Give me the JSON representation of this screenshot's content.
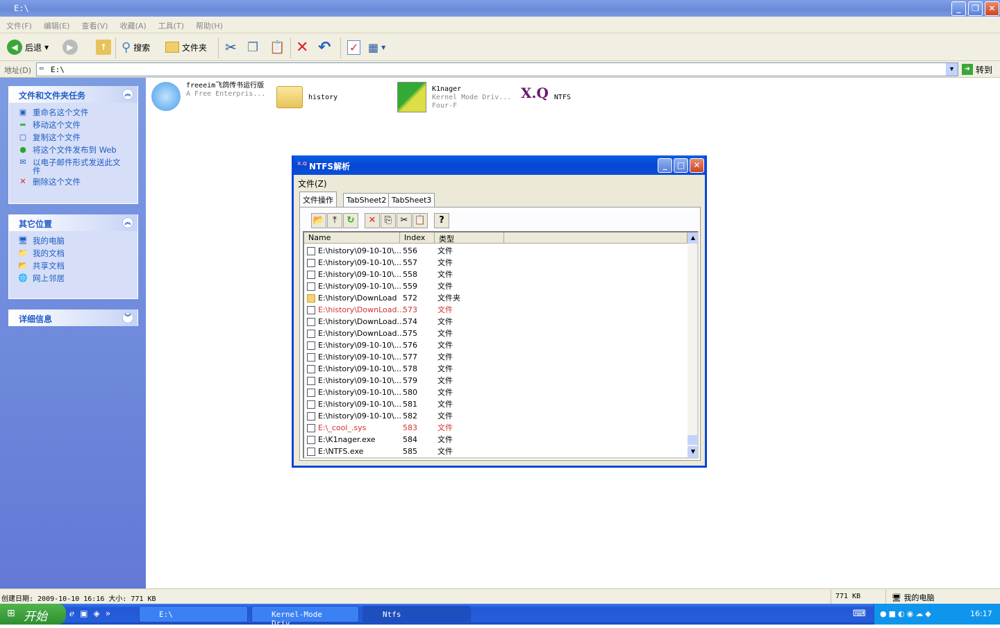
{
  "window": {
    "title": "E:\\",
    "min": "_",
    "max": "❐",
    "close": "✕"
  },
  "menu": [
    "文件(F)",
    "编辑(E)",
    "查看(V)",
    "收藏(A)",
    "工具(T)",
    "帮助(H)"
  ],
  "toolbar": {
    "back": "后退",
    "search": "搜索",
    "folders": "文件夹"
  },
  "address": {
    "label": "地址(D)",
    "value": "E:\\",
    "go": "转到"
  },
  "left": {
    "tasks": {
      "title": "文件和文件夹任务",
      "items": [
        "重命名这个文件",
        "移动这个文件",
        "复制这个文件",
        "将这个文件发布到 Web",
        "以电子邮件形式发送此文件",
        "删除这个文件"
      ]
    },
    "places": {
      "title": "其它位置",
      "items": [
        "我的电脑",
        "我的文档",
        "共享文档",
        "网上邻居"
      ]
    },
    "details": {
      "title": "详细信息"
    }
  },
  "files": [
    {
      "name": "freeeim飞鸽传书运行版",
      "sub": "A Free Enterpris..."
    },
    {
      "name": "history"
    },
    {
      "name": "K1nager",
      "sub": "Kernel Mode Driv...",
      "sub2": "Four-F"
    },
    {
      "name": "NTFS",
      "logo": "X.Q"
    }
  ],
  "dialog": {
    "title": "NTFS解析",
    "menu": "文件(Z)",
    "tabs": [
      "文件操作",
      "TabSheet2",
      "TabSheet3"
    ],
    "columns": [
      "Name",
      "Index",
      "类型"
    ],
    "rows": [
      {
        "name": "E:\\history\\09-10-10\\...",
        "index": "556",
        "type": "文件"
      },
      {
        "name": "E:\\history\\09-10-10\\...",
        "index": "557",
        "type": "文件"
      },
      {
        "name": "E:\\history\\09-10-10\\...",
        "index": "558",
        "type": "文件"
      },
      {
        "name": "E:\\history\\09-10-10\\...",
        "index": "559",
        "type": "文件"
      },
      {
        "name": "E:\\history\\DownLoad",
        "index": "572",
        "type": "文件夹",
        "folder": true
      },
      {
        "name": "E:\\history\\DownLoad...",
        "index": "573",
        "type": "文件",
        "highlight": true
      },
      {
        "name": "E:\\history\\DownLoad...",
        "index": "574",
        "type": "文件"
      },
      {
        "name": "E:\\history\\DownLoad...",
        "index": "575",
        "type": "文件"
      },
      {
        "name": "E:\\history\\09-10-10\\...",
        "index": "576",
        "type": "文件"
      },
      {
        "name": "E:\\history\\09-10-10\\...",
        "index": "577",
        "type": "文件"
      },
      {
        "name": "E:\\history\\09-10-10\\...",
        "index": "578",
        "type": "文件"
      },
      {
        "name": "E:\\history\\09-10-10\\...",
        "index": "579",
        "type": "文件"
      },
      {
        "name": "E:\\history\\09-10-10\\...",
        "index": "580",
        "type": "文件"
      },
      {
        "name": "E:\\history\\09-10-10\\...",
        "index": "581",
        "type": "文件"
      },
      {
        "name": "E:\\history\\09-10-10\\...",
        "index": "582",
        "type": "文件"
      },
      {
        "name": "E:\\_cool_.sys",
        "index": "583",
        "type": "文件",
        "highlight": true
      },
      {
        "name": "E:\\K1nager.exe",
        "index": "584",
        "type": "文件"
      },
      {
        "name": "E:\\NTFS.exe",
        "index": "585",
        "type": "文件"
      }
    ],
    "highlight_color": "#d03030"
  },
  "status": {
    "info": "创建日期: 2009-10-10 16:16 大小: 771 KB",
    "size": "771 KB",
    "zone": "我的电脑"
  },
  "taskbar": {
    "start": "开始",
    "tasks": [
      "E:\\",
      "Kernel-Mode Driv...",
      "Ntfs"
    ],
    "clock": "16:17"
  }
}
